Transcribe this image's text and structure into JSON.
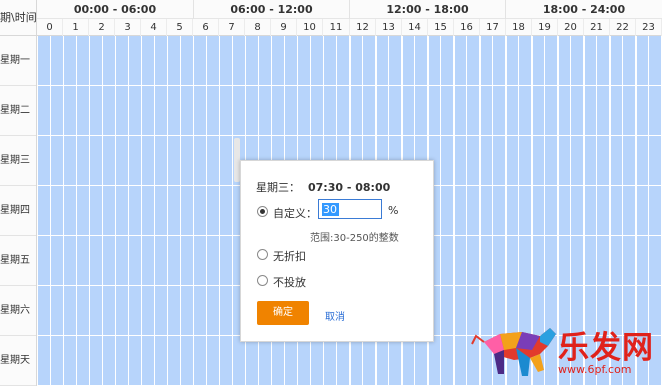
{
  "header": {
    "corner_label": "期\\时间",
    "periods": [
      "00:00 - 06:00",
      "06:00 - 12:00",
      "12:00 - 18:00",
      "18:00 - 24:00"
    ],
    "hours": [
      "0",
      "1",
      "2",
      "3",
      "4",
      "5",
      "6",
      "7",
      "8",
      "9",
      "10",
      "11",
      "12",
      "13",
      "14",
      "15",
      "16",
      "17",
      "18",
      "19",
      "20",
      "21",
      "22",
      "23"
    ]
  },
  "days": [
    "星期一",
    "星期二",
    "星期三",
    "星期四",
    "星期五",
    "星期六",
    "星期天"
  ],
  "grid": {
    "cell_color": "#b7d4fb",
    "line_color": "#ffffff"
  },
  "dialog": {
    "day": "星期三：",
    "time_range": "07:30 - 08:00",
    "options": [
      "自定义：",
      "无折扣",
      "不投放"
    ],
    "selected_option": "自定义：",
    "percent_value": "30",
    "percent_sign": "%",
    "range_hint": "范围:30-250的整数",
    "confirm_label": "确定",
    "cancel_label": "取消",
    "confirm_color": "#f08300"
  },
  "watermark": {
    "title": "乐发网",
    "url": "www.6pf.com"
  }
}
